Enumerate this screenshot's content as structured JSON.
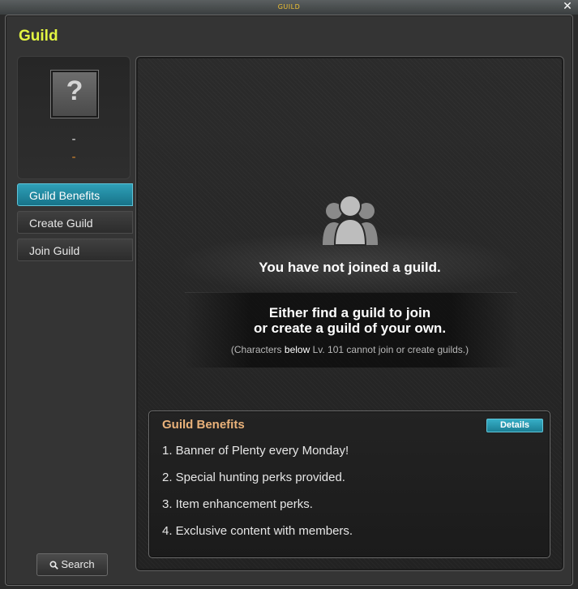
{
  "window": {
    "titlebar": "GUILD",
    "title": "Guild",
    "close_glyph": "✕"
  },
  "profile": {
    "emblem_glyph": "?",
    "name": "-",
    "level": "-"
  },
  "menu": {
    "items": [
      {
        "label": "Guild Benefits",
        "active": true
      },
      {
        "label": "Create Guild",
        "active": false
      },
      {
        "label": "Join Guild",
        "active": false
      }
    ],
    "search_label": "Search"
  },
  "main": {
    "not_joined": "You have not joined a guild.",
    "hint_line1": "Either find a guild to join",
    "hint_line2": "or create a guild of your own.",
    "restriction_prefix": "(Characters ",
    "restriction_highlight": "below",
    "restriction_suffix": " Lv. 101 cannot join or create guilds.)"
  },
  "benefits": {
    "title": "Guild Benefits",
    "details_label": "Details",
    "items": [
      "1. Banner of Plenty every Monday!",
      "2. Special hunting perks provided.",
      "3. Item enhancement perks.",
      "4. Exclusive content with members."
    ]
  },
  "icons": {
    "close": "close-icon",
    "search": "search-icon",
    "guild": "guild-members-icon",
    "emblem": "question-mark-icon"
  },
  "colors": {
    "title_yellow": "#e3f542",
    "accent_teal": "#1f8aa2",
    "benefits_title": "#eab27a",
    "level_orange": "#e08b2c"
  }
}
